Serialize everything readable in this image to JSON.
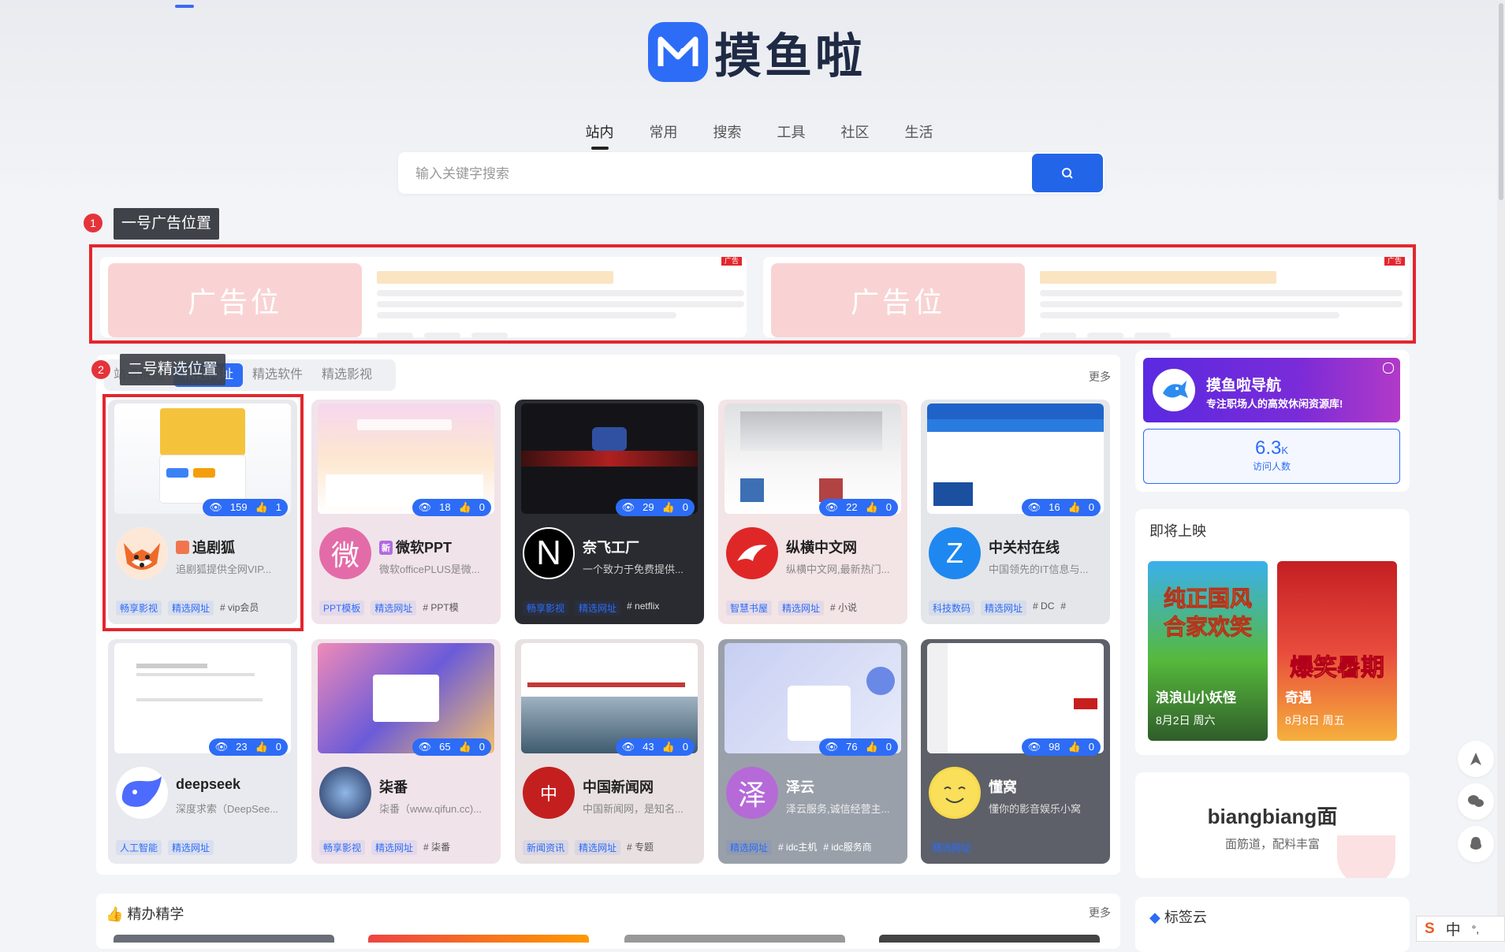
{
  "site": {
    "logo_text": "摸鱼啦"
  },
  "nav_tabs": [
    {
      "label": "站内",
      "active": true
    },
    {
      "label": "常用",
      "active": false
    },
    {
      "label": "搜索",
      "active": false
    },
    {
      "label": "工具",
      "active": false
    },
    {
      "label": "社区",
      "active": false
    },
    {
      "label": "生活",
      "active": false
    }
  ],
  "search": {
    "placeholder": "输入关键字搜索"
  },
  "annotations": {
    "ad": {
      "num": "1",
      "label": "一号广告位置"
    },
    "featured": {
      "num": "2",
      "label": "二号精选位置"
    }
  },
  "ads": [
    {
      "image_text": "广告位",
      "flag": "广告"
    },
    {
      "image_text": "广告位",
      "flag": "广告"
    }
  ],
  "featured": {
    "tabs": [
      {
        "label": "站点精选",
        "active": false
      },
      {
        "label": "精选网址",
        "active": true
      },
      {
        "label": "精选软件",
        "active": false
      },
      {
        "label": "精选影视",
        "active": false
      }
    ],
    "more": "更多",
    "cards": [
      {
        "title": "追剧狐",
        "prefix": "",
        "desc": "追剧狐提供全网VIP...",
        "views": "159",
        "likes": "1",
        "tags": [
          "畅享影视",
          "精选网址"
        ],
        "hashtags": [
          "# vip会员"
        ]
      },
      {
        "title": "微软PPT",
        "prefix": "新",
        "desc": "微软officePLUS是微...",
        "views": "18",
        "likes": "0",
        "tags": [
          "PPT模板",
          "精选网址"
        ],
        "hashtags": [
          "# PPT模"
        ]
      },
      {
        "title": "奈飞工厂",
        "prefix": "",
        "desc": "一个致力于免费提供...",
        "views": "29",
        "likes": "0",
        "tags": [
          "畅享影视",
          "精选网址"
        ],
        "hashtags": [
          "# netflix"
        ]
      },
      {
        "title": "纵横中文网",
        "prefix": "",
        "desc": "纵横中文网,最新热门...",
        "views": "22",
        "likes": "0",
        "tags": [
          "智慧书屋",
          "精选网址"
        ],
        "hashtags": [
          "# 小说"
        ]
      },
      {
        "title": "中关村在线",
        "prefix": "",
        "desc": "中国领先的IT信息与...",
        "views": "16",
        "likes": "0",
        "tags": [
          "科技数码",
          "精选网址"
        ],
        "hashtags": [
          "# DC",
          "#"
        ]
      },
      {
        "title": "deepseek",
        "prefix": "",
        "desc": "深度求索（DeepSee...",
        "views": "23",
        "likes": "0",
        "tags": [
          "人工智能",
          "精选网址"
        ],
        "hashtags": []
      },
      {
        "title": "柒番",
        "prefix": "",
        "desc": "柒番（www.qifun.cc)...",
        "views": "65",
        "likes": "0",
        "tags": [
          "畅享影视",
          "精选网址"
        ],
        "hashtags": [
          "# 柒番"
        ]
      },
      {
        "title": "中国新闻网",
        "prefix": "",
        "desc": "中国新闻网，是知名...",
        "views": "43",
        "likes": "0",
        "tags": [
          "新闻资讯",
          "精选网址"
        ],
        "hashtags": [
          "# 专题"
        ]
      },
      {
        "title": "泽云",
        "prefix": "",
        "desc": "泽云服务,诚信经营主...",
        "views": "76",
        "likes": "0",
        "tags": [
          "精选网址"
        ],
        "hashtags": [
          "# idc主机",
          "# idc服务商"
        ]
      },
      {
        "title": "懂窝",
        "prefix": "",
        "desc": "懂你的影音娱乐小窝",
        "views": "98",
        "likes": "0",
        "tags": [
          "精选网址"
        ],
        "hashtags": []
      }
    ],
    "avatar_letters": [
      "",
      "微",
      "N",
      "",
      "Z",
      "",
      "",
      "中",
      "泽",
      ""
    ]
  },
  "section2": {
    "title": "精办精学",
    "more": "更多"
  },
  "sidebar": {
    "brand": {
      "title": "摸鱼啦导航",
      "subtitle": "专注职场人的高效休闲资源库!"
    },
    "visits": {
      "value": "6.3",
      "unit": "K",
      "label": "访问人数"
    },
    "upcoming": {
      "title": "即将上映",
      "movies": [
        {
          "title": "浪浪山小妖怪",
          "date": "8月2日 周六",
          "poster_text": "纯正国风 合家欢笑"
        },
        {
          "title": "奇遇",
          "date": "8月8日 周五",
          "poster_text": "爆笑暑期"
        }
      ]
    },
    "food": {
      "title": "biangbiang面",
      "subtitle": "面筋道，配料丰富"
    },
    "tags": {
      "title": "标签云"
    }
  },
  "ime": {
    "lang": "中",
    "punct": "°,"
  }
}
